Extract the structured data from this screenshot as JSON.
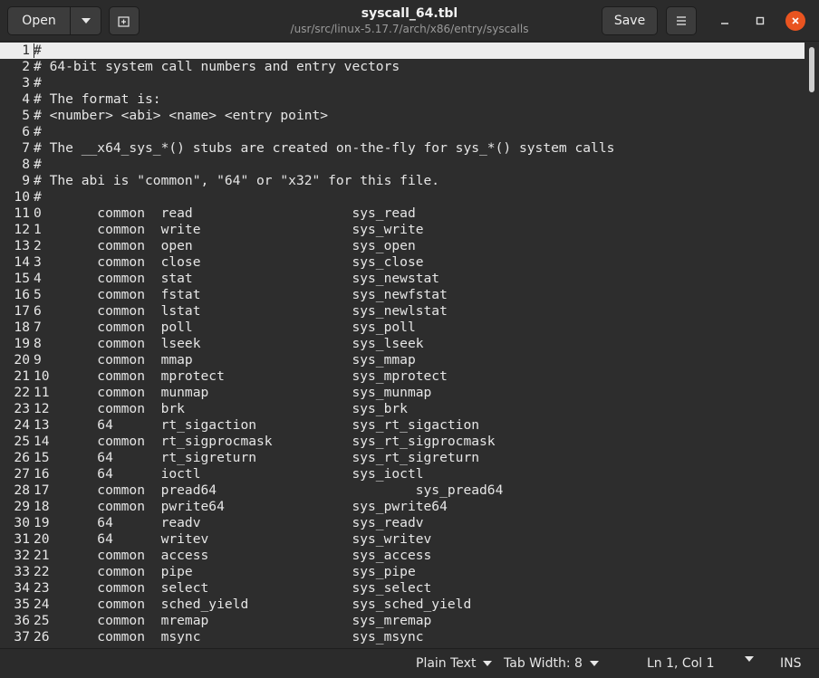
{
  "header": {
    "open_label": "Open",
    "title": "syscall_64.tbl",
    "path": "/usr/src/linux-5.17.7/arch/x86/entry/syscalls",
    "save_label": "Save"
  },
  "editor": {
    "lines": [
      {
        "n": "1",
        "text": "#"
      },
      {
        "n": "2",
        "text": "# 64-bit system call numbers and entry vectors"
      },
      {
        "n": "3",
        "text": "#"
      },
      {
        "n": "4",
        "text": "# The format is:"
      },
      {
        "n": "5",
        "text": "# <number> <abi> <name> <entry point>"
      },
      {
        "n": "6",
        "text": "#"
      },
      {
        "n": "7",
        "text": "# The __x64_sys_*() stubs are created on-the-fly for sys_*() system calls"
      },
      {
        "n": "8",
        "text": "#"
      },
      {
        "n": "9",
        "text": "# The abi is \"common\", \"64\" or \"x32\" for this file."
      },
      {
        "n": "10",
        "text": "#"
      },
      {
        "n": "11",
        "text": "0       common  read                    sys_read"
      },
      {
        "n": "12",
        "text": "1       common  write                   sys_write"
      },
      {
        "n": "13",
        "text": "2       common  open                    sys_open"
      },
      {
        "n": "14",
        "text": "3       common  close                   sys_close"
      },
      {
        "n": "15",
        "text": "4       common  stat                    sys_newstat"
      },
      {
        "n": "16",
        "text": "5       common  fstat                   sys_newfstat"
      },
      {
        "n": "17",
        "text": "6       common  lstat                   sys_newlstat"
      },
      {
        "n": "18",
        "text": "7       common  poll                    sys_poll"
      },
      {
        "n": "19",
        "text": "8       common  lseek                   sys_lseek"
      },
      {
        "n": "20",
        "text": "9       common  mmap                    sys_mmap"
      },
      {
        "n": "21",
        "text": "10      common  mprotect                sys_mprotect"
      },
      {
        "n": "22",
        "text": "11      common  munmap                  sys_munmap"
      },
      {
        "n": "23",
        "text": "12      common  brk                     sys_brk"
      },
      {
        "n": "24",
        "text": "13      64      rt_sigaction            sys_rt_sigaction"
      },
      {
        "n": "25",
        "text": "14      common  rt_sigprocmask          sys_rt_sigprocmask"
      },
      {
        "n": "26",
        "text": "15      64      rt_sigreturn            sys_rt_sigreturn"
      },
      {
        "n": "27",
        "text": "16      64      ioctl                   sys_ioctl"
      },
      {
        "n": "28",
        "text": "17      common  pread64                         sys_pread64"
      },
      {
        "n": "29",
        "text": "18      common  pwrite64                sys_pwrite64"
      },
      {
        "n": "30",
        "text": "19      64      readv                   sys_readv"
      },
      {
        "n": "31",
        "text": "20      64      writev                  sys_writev"
      },
      {
        "n": "32",
        "text": "21      common  access                  sys_access"
      },
      {
        "n": "33",
        "text": "22      common  pipe                    sys_pipe"
      },
      {
        "n": "34",
        "text": "23      common  select                  sys_select"
      },
      {
        "n": "35",
        "text": "24      common  sched_yield             sys_sched_yield"
      },
      {
        "n": "36",
        "text": "25      common  mremap                  sys_mremap"
      },
      {
        "n": "37",
        "text": "26      common  msync                   sys_msync"
      }
    ]
  },
  "statusbar": {
    "language": "Plain Text",
    "tab_width": "Tab Width: 8",
    "position": "Ln 1, Col 1",
    "mode": "INS"
  },
  "icons": {
    "open_arrow": "chevron-down-icon",
    "new_tab": "new-tab-icon",
    "menu": "hamburger-menu-icon",
    "minimize": "minimize-icon",
    "maximize": "maximize-icon",
    "close": "close-icon"
  },
  "colors": {
    "accent_close": "#e95420",
    "background": "#2d2d2d",
    "current_line": "#ececec"
  }
}
